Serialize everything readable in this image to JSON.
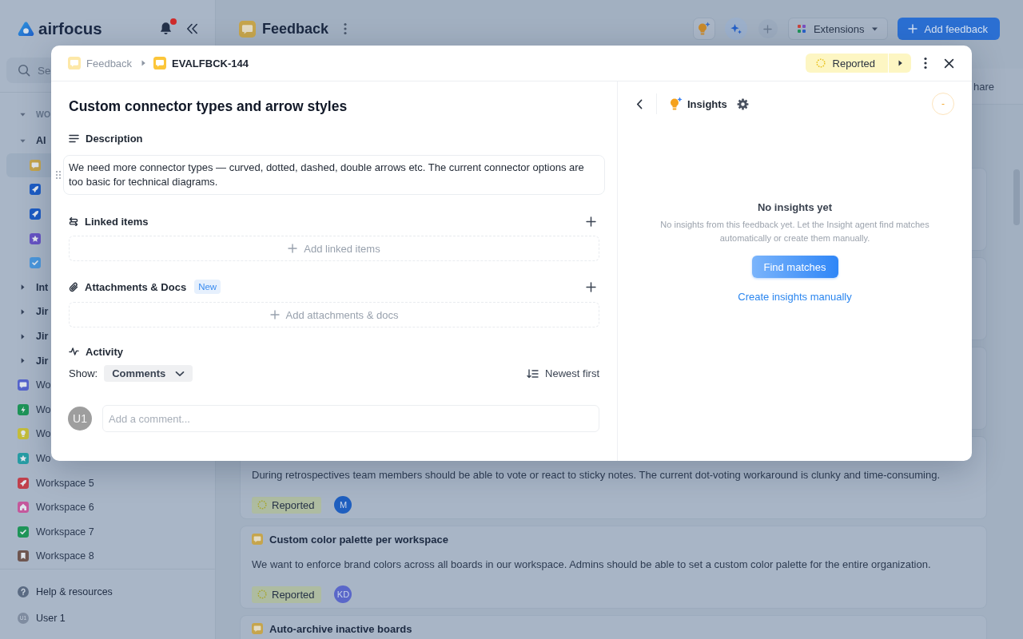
{
  "sidebar": {
    "logo": "airfocus",
    "notifications": {
      "unread": true
    },
    "search": {
      "placeholder": "Se"
    },
    "tree": [
      {
        "kind": "section",
        "label": "WO",
        "expanded": true
      },
      {
        "kind": "folder",
        "label": "AI",
        "expanded": true,
        "children": [
          {
            "color": "#c6a54c",
            "selected": true
          },
          {
            "color": "#1d5cc4",
            "selected": false
          },
          {
            "color": "#1d5cc4",
            "selected": false
          },
          {
            "color": "#6753c4",
            "selected": false
          },
          {
            "color": "#4b97dc",
            "selected": false
          }
        ]
      },
      {
        "kind": "folder",
        "label": "Int",
        "expanded": false
      },
      {
        "kind": "folder",
        "label": "Jir",
        "expanded": false
      },
      {
        "kind": "folder",
        "label": "Jir",
        "expanded": false
      },
      {
        "kind": "folder",
        "label": "Jir",
        "expanded": false
      }
    ],
    "workspaces": [
      {
        "label": "Wo",
        "color": "#5564cc"
      },
      {
        "label": "Wo",
        "color": "#1e9458"
      },
      {
        "label": "Wo",
        "color": "#c4bd3a"
      },
      {
        "label": "Wo",
        "color": "#279ca4"
      },
      {
        "label": "Workspace 5",
        "color": "#c0404c"
      },
      {
        "label": "Workspace 6",
        "color": "#c4589c"
      },
      {
        "label": "Workspace 7",
        "color": "#1e9458"
      },
      {
        "label": "Workspace 8",
        "color": "#6e5650"
      }
    ],
    "footer": [
      {
        "kind": "help",
        "label": "Help & resources"
      },
      {
        "kind": "user",
        "label": "User 1",
        "initials": "U1"
      }
    ]
  },
  "main": {
    "title": "Feedback",
    "actions": [
      "Extensions",
      "Add feedback"
    ],
    "toolbar": {
      "share": "hare"
    },
    "cards": [
      {
        "description": "During retrospectives team members should be able to vote or react to sticky notes. The current dot-voting workaround is clunky and time-consuming.",
        "status": "Reported",
        "avatar": {
          "initials": "M",
          "color": "#1f5fbf"
        }
      },
      {
        "title": "Custom color palette per workspace",
        "description": "We want to enforce brand colors across all boards in our workspace. Admins should be able to set a custom color palette for the entire organization.",
        "status": "Reported",
        "avatar": {
          "initials": "KD",
          "color": "#5a67c9"
        }
      },
      {
        "title": "Auto-archive inactive boards"
      }
    ]
  },
  "modal": {
    "breadcrumb": [
      {
        "label": "Feedback",
        "current": false
      },
      {
        "label": "EVALFBCK-144",
        "current": true
      }
    ],
    "status": "Reported",
    "title": "Custom connector types and arrow styles",
    "sections": [
      {
        "kind": "description",
        "heading": "Description",
        "text": "We need more connector types — curved, dotted, dashed, double arrows etc. The current connector options are too basic for technical diagrams."
      },
      {
        "kind": "linked",
        "heading": "Linked items",
        "add_label": "Add linked items"
      },
      {
        "kind": "attachments",
        "heading": "Attachments & Docs",
        "badge": "New",
        "add_label": "Add attachments & docs"
      },
      {
        "kind": "activity",
        "heading": "Activity",
        "show_label": "Show:",
        "filter": "Comments",
        "sort": "Newest first",
        "avatar": "U1",
        "placeholder": "Add a comment..."
      }
    ],
    "insights": {
      "title": "Insights",
      "score": "-",
      "empty_title": "No insights yet",
      "empty_text": "No insights from this feedback yet. Let the Insight agent find matches automatically or create them manually.",
      "primary_action": "Find matches",
      "secondary_action": "Create insights manually"
    }
  }
}
